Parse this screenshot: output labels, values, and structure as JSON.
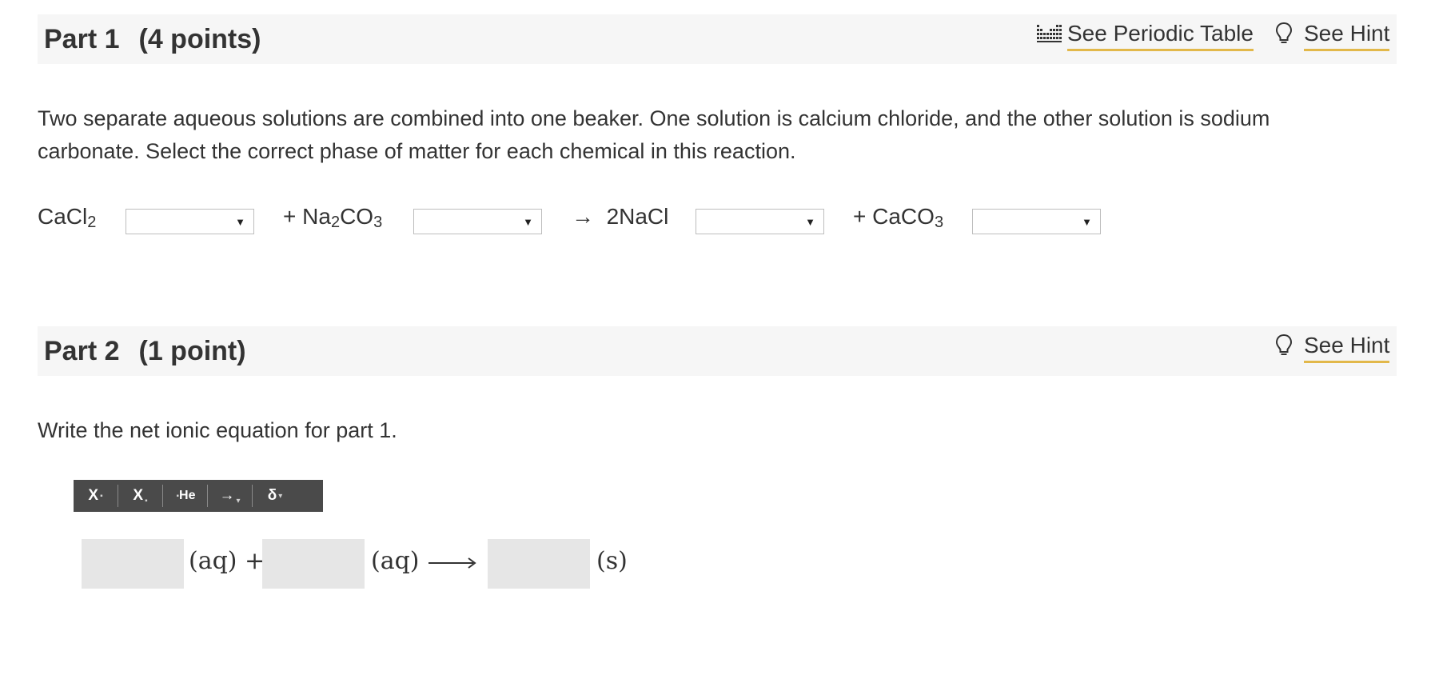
{
  "part1": {
    "title": "Part 1",
    "points": "(4 points)",
    "periodic_table_label": "See Periodic Table",
    "hint_label": "See Hint",
    "question": "Two separate aqueous solutions are combined into one beaker. One solution is calcium chloride, and the other solution is sodium carbonate. Select the correct phase of matter for each chemical in this reaction.",
    "equation": {
      "reactant1": "CaCl",
      "reactant1_sub": "2",
      "plus": "+",
      "reactant2_a": "Na",
      "reactant2_sub1": "2",
      "reactant2_b": "CO",
      "reactant2_sub2": "3",
      "arrow": "→",
      "product1": "2NaCl",
      "product2": "CaCO",
      "product2_sub": "3",
      "dropdown_arrow": "▼"
    }
  },
  "part2": {
    "title": "Part 2",
    "points": "(1 point)",
    "hint_label": "See Hint",
    "question": "Write the net ionic equation for part 1.",
    "toolbar": {
      "superscript": "X",
      "subscript": "X",
      "element": "He",
      "arrow": "→",
      "delta": "δ"
    },
    "phase1": "(aq)",
    "plus": "+",
    "phase2": "(aq)",
    "phase3": "(s)"
  },
  "colors": {
    "header_bg": "#f6f6f6",
    "link_underline": "#e2b84a",
    "toolbar_bg": "#4a4a4a",
    "answer_box_bg": "#e6e6e6"
  }
}
